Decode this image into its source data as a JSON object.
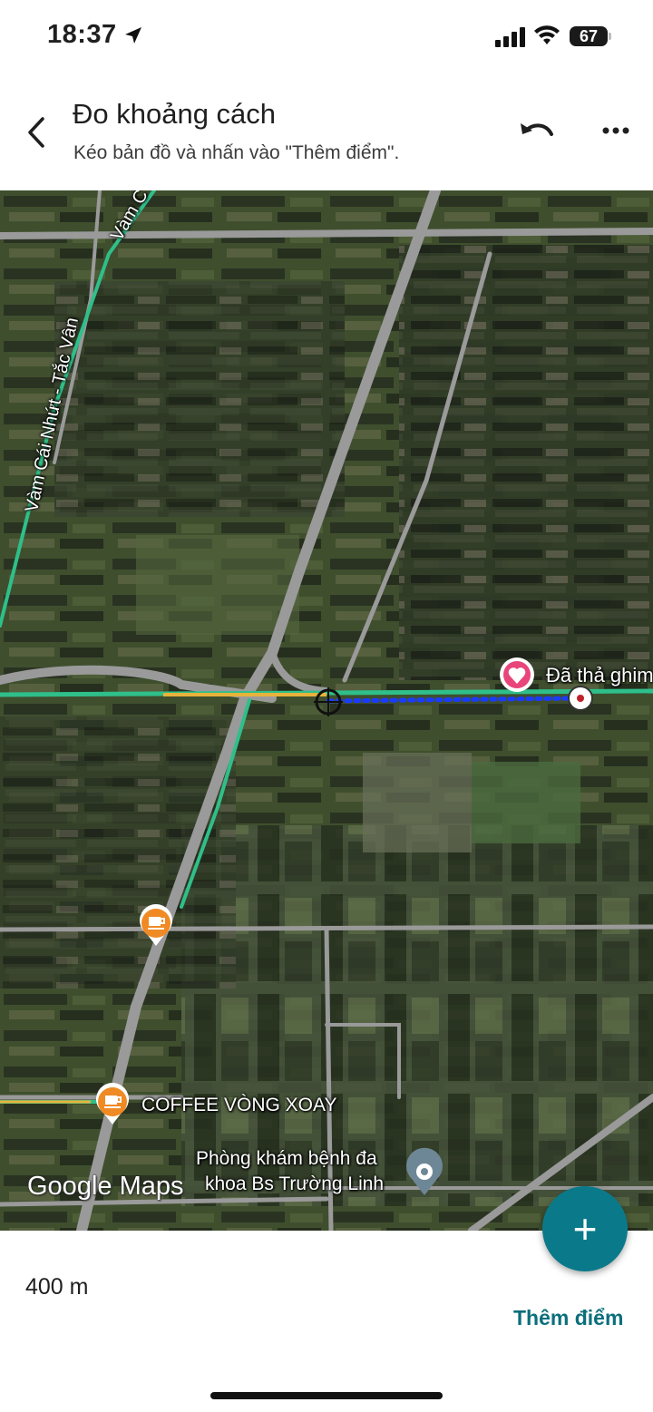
{
  "status_bar": {
    "time": "18:37",
    "battery": "67"
  },
  "header": {
    "title": "Đo khoảng cách",
    "subtitle": "Kéo bản đồ và nhấn vào \"Thêm điểm\"."
  },
  "map": {
    "road_label_1": "Vàm Cái Nhứt - Tắc Vân",
    "road_label_2": "Vàm C",
    "dropped_pin_label": "Đã thả ghim",
    "coffee_label": "COFFEE VÒNG XOAY",
    "clinic_label_line1": "Phòng khám bệnh đa",
    "clinic_label_line2": "khoa Bs Trường Linh",
    "logo": "Google Maps"
  },
  "bottom": {
    "distance": "400 m",
    "add_point_label": "Thêm điểm",
    "fab_label": "+"
  },
  "colors": {
    "accent": "#0b6f7c",
    "fab": "#0a7a8a",
    "measure_line": "#1a3cff",
    "road_green": "#2fbf8a"
  }
}
